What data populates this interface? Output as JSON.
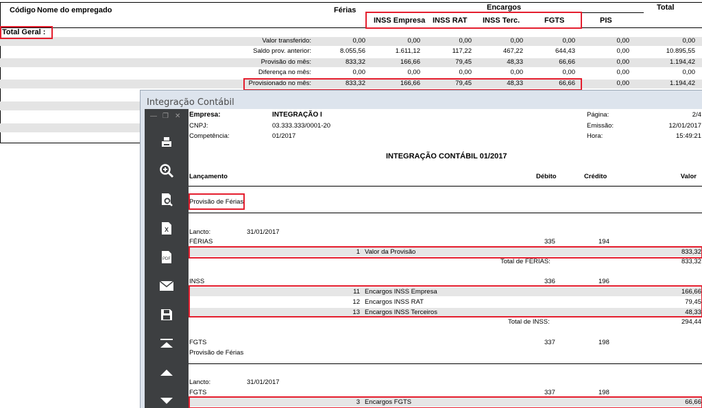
{
  "report": {
    "header": {
      "codigo": "Código",
      "nome": "Nome do empregado",
      "ferias": "Férias",
      "encargos": "Encargos",
      "total": "Total",
      "sub_cols": [
        "INSS Empresa",
        "INSS RAT",
        "INSS Terc.",
        "FGTS",
        "PIS"
      ]
    },
    "total_geral": "Total Geral :",
    "rows": [
      {
        "label": "Valor transferido:",
        "values": [
          "0,00",
          "0,00",
          "0,00",
          "0,00",
          "0,00",
          "0,00",
          "0,00"
        ]
      },
      {
        "label": "Saldo prov. anterior:",
        "values": [
          "8.055,56",
          "1.611,12",
          "117,22",
          "467,22",
          "644,43",
          "0,00",
          "10.895,55"
        ]
      },
      {
        "label": "Provisão do mês:",
        "values": [
          "833,32",
          "166,66",
          "79,45",
          "48,33",
          "66,66",
          "0,00",
          "1.194,42"
        ]
      },
      {
        "label": "Diferença no mês:",
        "values": [
          "0,00",
          "0,00",
          "0,00",
          "0,00",
          "0,00",
          "0,00",
          "0,00"
        ]
      },
      {
        "label": "Provisionado no mês:",
        "values": [
          "833,32",
          "166,66",
          "79,45",
          "48,33",
          "66,66",
          "0,00",
          "1.194,42"
        ]
      }
    ]
  },
  "preview": {
    "window_title": "Integração Contábil",
    "toolbar": [
      {
        "icon": "printer-icon"
      },
      {
        "icon": "zoom-in-icon"
      },
      {
        "icon": "zoom-page-icon"
      },
      {
        "icon": "excel-export-icon"
      },
      {
        "icon": "pdf-export-icon",
        "text": "PDF"
      },
      {
        "icon": "email-icon"
      },
      {
        "icon": "save-icon"
      },
      {
        "icon": "first-page-icon"
      },
      {
        "icon": "previous-page-icon"
      },
      {
        "icon": "next-page-icon"
      }
    ],
    "page": {
      "empresa_label": "Empresa:",
      "empresa_value": "INTEGRAÇÃO I",
      "cnpj_label": "CNPJ:",
      "cnpj_value": "03.333.333/0001-20",
      "competencia_label": "Competência:",
      "competencia_value": "01/2017",
      "pagina_label": "Página:",
      "pagina_value": "2/4",
      "emissao_label": "Emissão:",
      "emissao_value": "12/01/2017",
      "hora_label": "Hora:",
      "hora_value": "15:49:21",
      "report_title": "INTEGRAÇÃO CONTÁBIL 01/2017",
      "col_lancamento": "Lançamento",
      "col_debito": "Débito",
      "col_credito": "Crédito",
      "col_valor": "Valor",
      "section_title": "Provisão de Férias",
      "lancto_label": "Lancto:",
      "lancto_date": "31/01/2017",
      "ferias": {
        "name": "FÉRIAS",
        "debito": "335",
        "credito": "194",
        "item": {
          "num": "1",
          "desc": "Valor da Provisão",
          "valor": "833,32"
        },
        "total_label": "Total de FÉRIAS:",
        "total_value": "833,32"
      },
      "inss": {
        "name": "INSS",
        "debito": "336",
        "credito": "196",
        "items": [
          {
            "num": "11",
            "desc": "Encargos INSS Empresa",
            "valor": "166,66"
          },
          {
            "num": "12",
            "desc": "Encargos INSS RAT",
            "valor": "79,45"
          },
          {
            "num": "13",
            "desc": "Encargos INSS Terceiros",
            "valor": "48,33"
          }
        ],
        "total_label": "Total de INSS:",
        "total_value": "294,44"
      },
      "fgts": {
        "name": "FGTS",
        "debito": "337",
        "credito": "198",
        "subtitle": "Provisão de Férias"
      },
      "fgts2": {
        "lancto_date": "31/01/2017",
        "name": "FGTS",
        "debito": "337",
        "credito": "198",
        "item": {
          "num": "3",
          "desc": "Encargos FGTS",
          "valor": "66,66"
        }
      }
    }
  },
  "colors": {
    "highlight": "#e41d2d",
    "toolbar": "#3d3f41",
    "window_bg": "#dde4ed",
    "stripe": "#e4e4e4"
  }
}
